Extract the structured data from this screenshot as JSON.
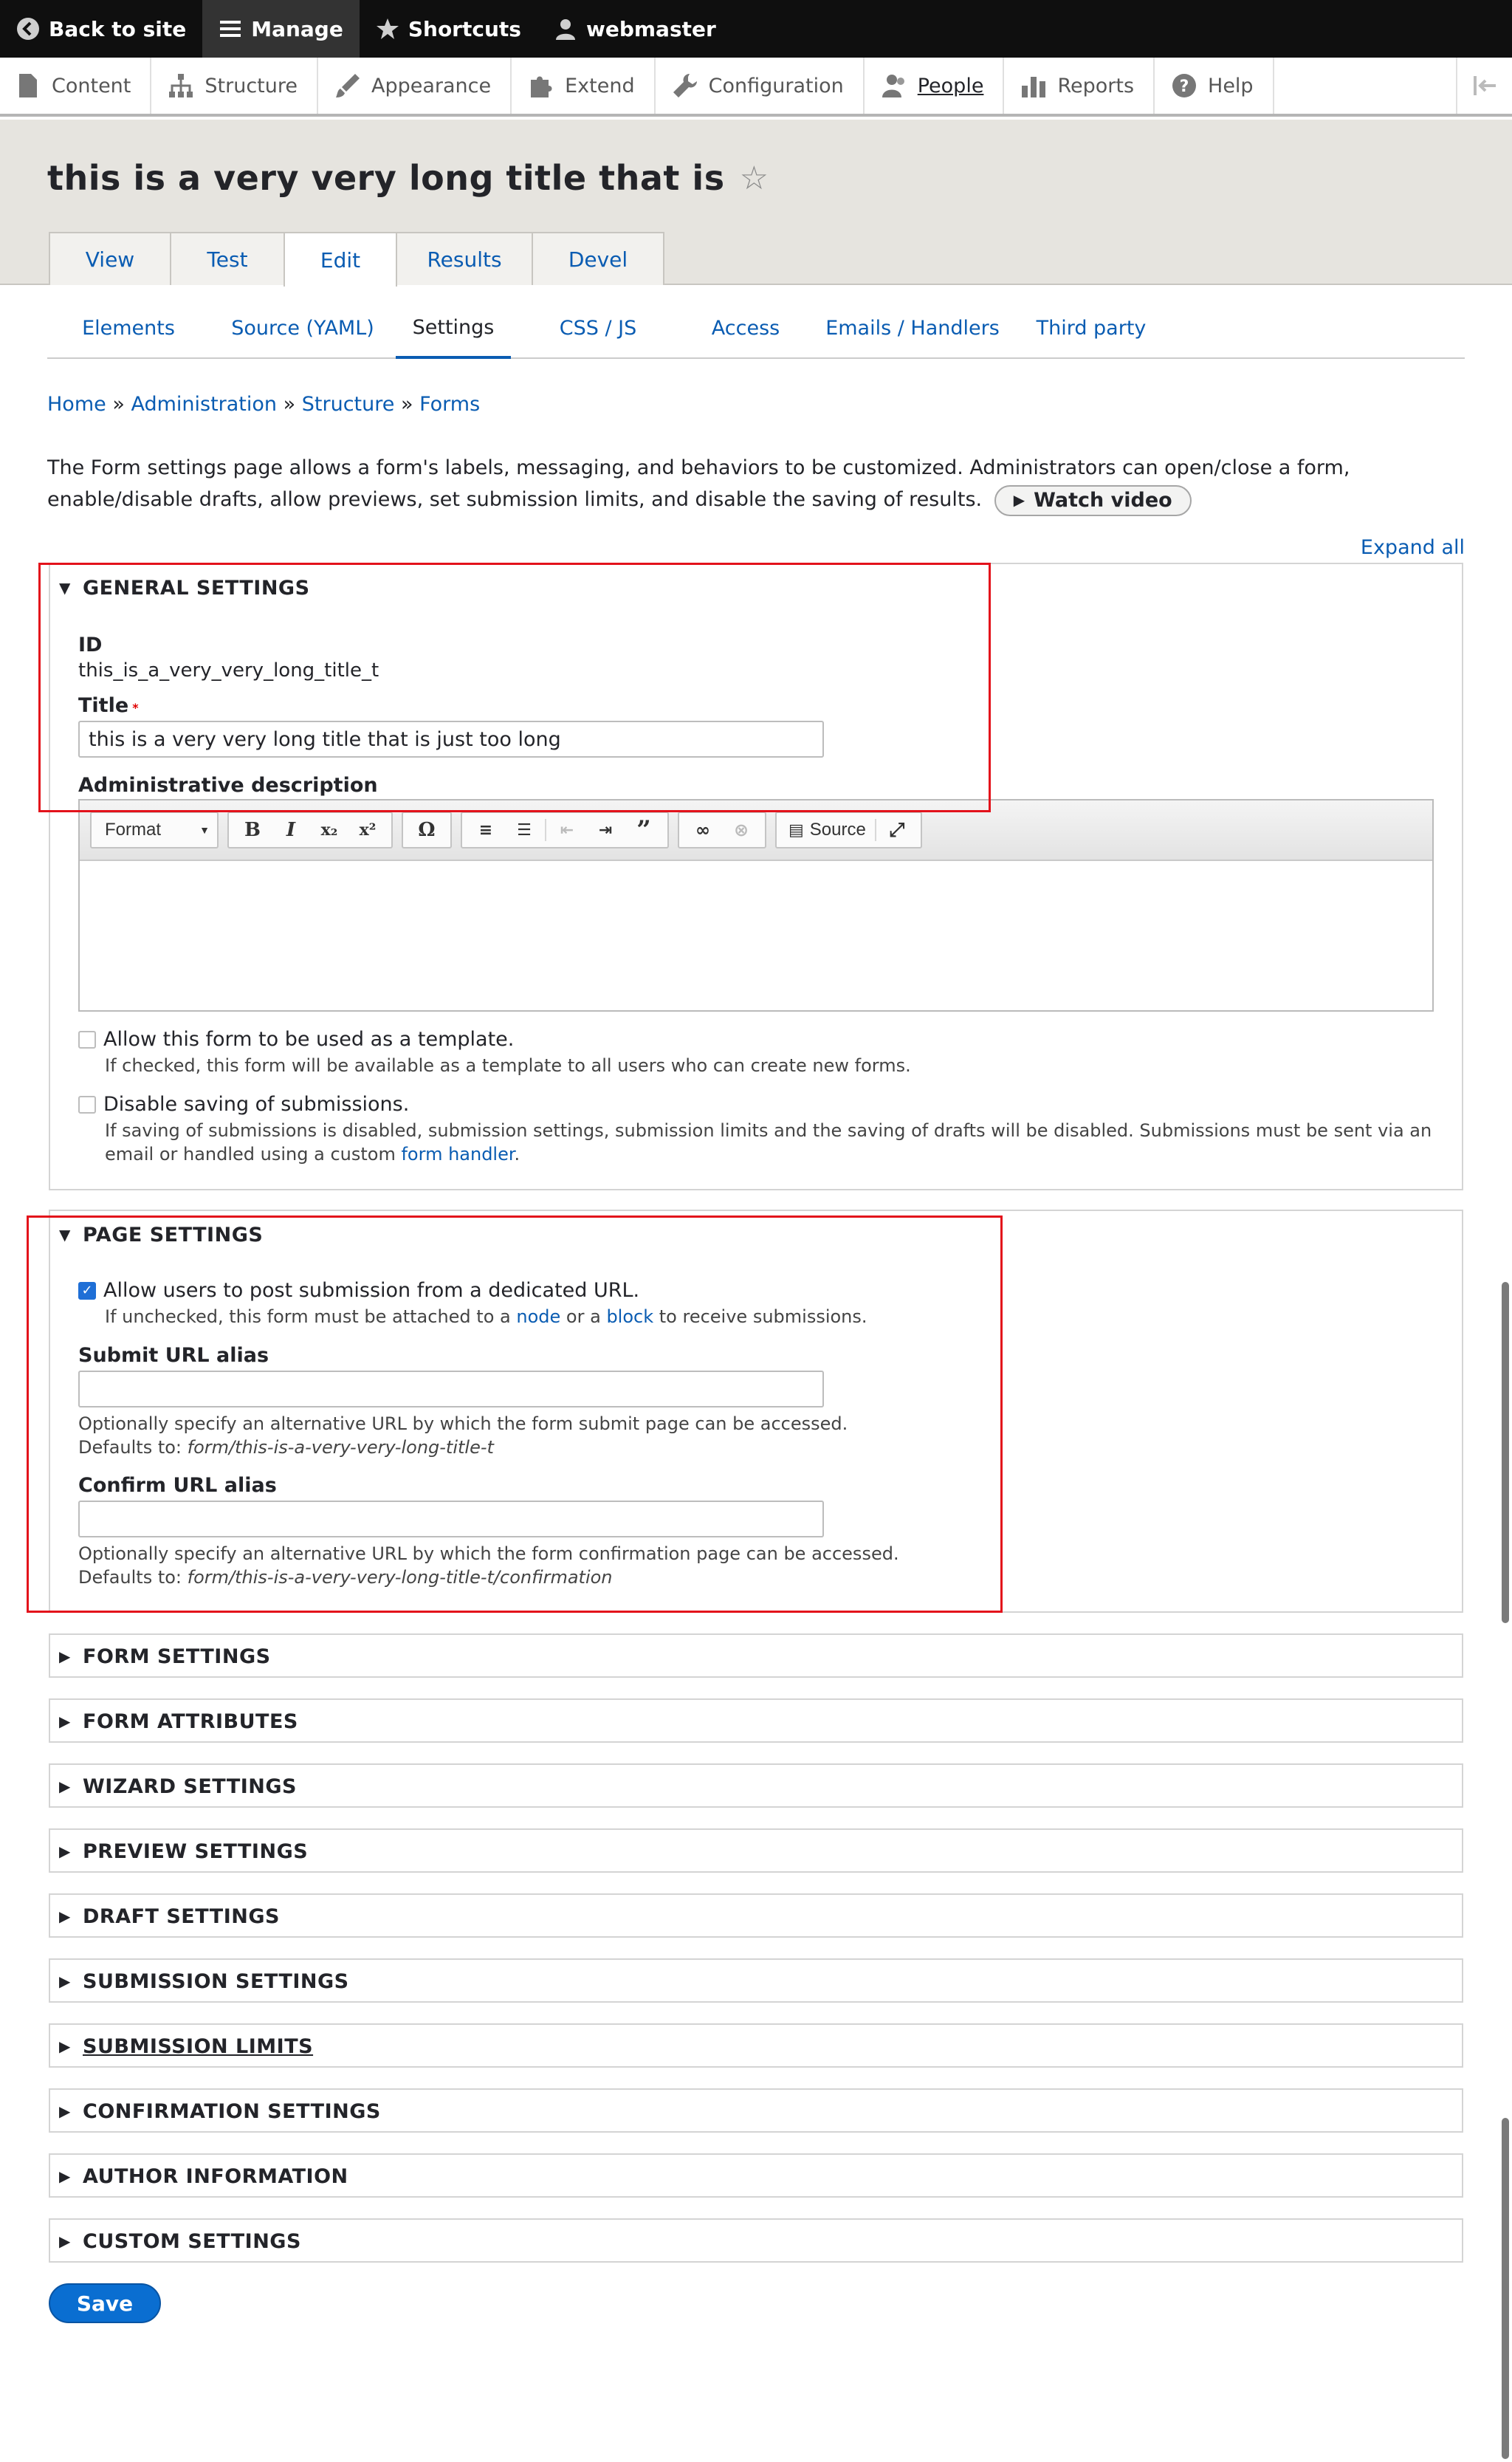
{
  "toolbar": {
    "back_to_site": "Back to site",
    "manage": "Manage",
    "shortcuts": "Shortcuts",
    "user": "webmaster"
  },
  "tray": {
    "items": [
      {
        "label": "Content",
        "icon": "file-icon"
      },
      {
        "label": "Structure",
        "icon": "structure-icon"
      },
      {
        "label": "Appearance",
        "icon": "paintbrush-icon"
      },
      {
        "label": "Extend",
        "icon": "puzzle-icon"
      },
      {
        "label": "Configuration",
        "icon": "wrench-icon"
      },
      {
        "label": "People",
        "icon": "people-icon"
      },
      {
        "label": "Reports",
        "icon": "bar-chart-icon"
      },
      {
        "label": "Help",
        "icon": "help-icon"
      }
    ],
    "collapse_icon": "collapse-icon"
  },
  "page": {
    "title": "this is a very very long title that is",
    "tabs": [
      "View",
      "Test",
      "Edit",
      "Results",
      "Devel"
    ],
    "active_tab": "Edit"
  },
  "subtabs": {
    "items": [
      "Elements",
      "Source (YAML)",
      "Settings",
      "CSS / JS",
      "Access",
      "Emails / Handlers",
      "Third party"
    ],
    "active": "Settings"
  },
  "breadcrumb": {
    "items": [
      "Home",
      "Administration",
      "Structure",
      "Forms"
    ],
    "separator": "»"
  },
  "help": {
    "text": "The Form settings page allows a form's labels, messaging, and behaviors to be customized. Administrators can open/close a form, enable/disable drafts, allow previews, set submission limits, and disable the saving of results.",
    "video_button": "Watch video"
  },
  "expand_all": "Expand all",
  "general": {
    "heading": "GENERAL SETTINGS",
    "id_label": "ID",
    "id_value": "this_is_a_very_very_long_title_t",
    "title_label": "Title",
    "title_required": "*",
    "title_value": "this is a very very long title that is just too long",
    "admin_desc_label": "Administrative description",
    "editor": {
      "format_label": "Format",
      "source_label": "Source"
    },
    "template_checkbox": {
      "label": "Allow this form to be used as a template.",
      "description": "If checked, this form will be available as a template to all users who can create new forms.",
      "checked": false
    },
    "disable_saving_checkbox": {
      "label": "Disable saving of submissions.",
      "description_1": "If saving of submissions is disabled, submission settings, submission limits and the saving of drafts will be disabled. Submissions must be sent via an email or handled using a custom",
      "description_link": "form handler",
      "description_2": ".",
      "checked": false
    }
  },
  "page_settings": {
    "heading": "PAGE SETTINGS",
    "dedicated_url_checkbox": {
      "label": "Allow users to post submission from a dedicated URL.",
      "desc_1": "If unchecked, this form must be attached to a",
      "link_node": "node",
      "desc_2": "or a",
      "link_block": "block",
      "desc_3": "to receive submissions.",
      "checked": true
    },
    "submit_alias": {
      "label": "Submit URL alias",
      "value": "",
      "description": "Optionally specify an alternative URL by which the form submit page can be accessed.",
      "defaults_prefix": "Defaults to:",
      "defaults_value": "form/this-is-a-very-very-long-title-t"
    },
    "confirm_alias": {
      "label": "Confirm URL alias",
      "value": "",
      "description": "Optionally specify an alternative URL by which the form confirmation page can be accessed.",
      "defaults_prefix": "Defaults to:",
      "defaults_value": "form/this-is-a-very-very-long-title-t/confirmation"
    }
  },
  "collapsed_sections": [
    "FORM SETTINGS",
    "FORM ATTRIBUTES",
    "WIZARD SETTINGS",
    "PREVIEW SETTINGS",
    "DRAFT SETTINGS",
    "SUBMISSION SETTINGS",
    "SUBMISSION LIMITS",
    "CONFIRMATION SETTINGS",
    "AUTHOR INFORMATION",
    "CUSTOM SETTINGS"
  ],
  "save_button": "Save",
  "colors": {
    "link": "#0a5cb2",
    "highlight_box": "#e3121b",
    "primary_button": "#0a6ed1"
  }
}
